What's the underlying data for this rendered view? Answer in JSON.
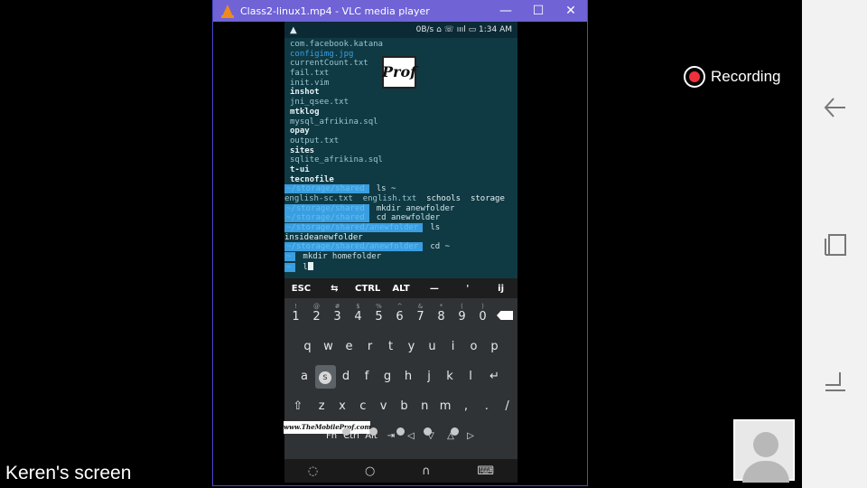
{
  "vlc": {
    "title": "Class2-linux1.mp4 - VLC media player",
    "minimize": "—",
    "maximize": "☐",
    "close": "✕"
  },
  "phone": {
    "status": {
      "warning": "▲",
      "indicators": "0B/s ⌂ ☏ ıııl ▭ 1:34 AM"
    },
    "logo_text": "Prof",
    "terminal": {
      "files": [
        {
          "text": "com.facebook.katana",
          "style": "plain"
        },
        {
          "text": "configimg.jpg",
          "style": "blue"
        },
        {
          "text": "currentCount.txt",
          "style": "plain"
        },
        {
          "text": "fail.txt",
          "style": "plain"
        },
        {
          "text": "init.vim",
          "style": "plain"
        },
        {
          "text": "inshot",
          "style": "bold"
        },
        {
          "text": "jni_qsee.txt",
          "style": "plain"
        },
        {
          "text": "mtklog",
          "style": "bold"
        },
        {
          "text": "mysql_afrikina.sql",
          "style": "plain"
        },
        {
          "text": "opay",
          "style": "bold"
        },
        {
          "text": "output.txt",
          "style": "plain"
        },
        {
          "text": "sites",
          "style": "bold"
        },
        {
          "text": "sqlite_afrikina.sql",
          "style": "plain"
        },
        {
          "text": "t-ui",
          "style": "bold"
        },
        {
          "text": "tecnofile",
          "style": "bold"
        }
      ],
      "session": [
        {
          "prompt": "~/storage/shared",
          "cmd": "ls ~"
        },
        {
          "output": [
            "english-sc.txt",
            "english.txt",
            "schools",
            "storage"
          ]
        },
        {
          "prompt": "~/storage/shared",
          "cmd": "mkdir anewfolder"
        },
        {
          "prompt": "~/storage/shared",
          "cmd": "cd anewfolder"
        },
        {
          "prompt": "~/storage/shared/anewfolder",
          "cmd": "ls"
        },
        {
          "output": [
            "insideanewfolder"
          ]
        },
        {
          "prompt": "~/storage/shared/anewfolder",
          "cmd": "cd ~"
        },
        {
          "prompt": "~",
          "cmd": "mkdir homefolder"
        },
        {
          "prompt": "~",
          "cmd": "l"
        }
      ]
    },
    "extra_keys": [
      "ESC",
      "⇆",
      "CTRL",
      "ALT",
      "—",
      "'",
      "ij"
    ],
    "keyboard": {
      "number_row": [
        {
          "k": "1",
          "s": "!"
        },
        {
          "k": "2",
          "s": "@"
        },
        {
          "k": "3",
          "s": "#"
        },
        {
          "k": "4",
          "s": "$"
        },
        {
          "k": "5",
          "s": "%"
        },
        {
          "k": "6",
          "s": "^"
        },
        {
          "k": "7",
          "s": "&"
        },
        {
          "k": "8",
          "s": "*"
        },
        {
          "k": "9",
          "s": "("
        },
        {
          "k": "0",
          "s": ")"
        }
      ],
      "row1": [
        "q",
        "w",
        "e",
        "r",
        "t",
        "y",
        "u",
        "i",
        "o",
        "p"
      ],
      "row2": [
        "a",
        "s",
        "d",
        "f",
        "g",
        "h",
        "j",
        "k",
        "l"
      ],
      "row3": [
        "z",
        "x",
        "c",
        "v",
        "b",
        "n",
        "m",
        ",",
        ".",
        "/"
      ],
      "pressed": "s",
      "bottom_row": [
        "Fn",
        "Ctrl",
        "Alt",
        "⇥",
        "◁",
        "▽",
        "△",
        "▷"
      ],
      "enter": "↵",
      "shift": "⇧"
    },
    "watermark": "www.TheMobileProf.com",
    "nav": [
      "◌",
      "○",
      "∩",
      "⌨"
    ]
  },
  "recording_label": "Recording",
  "screen_owner": "Keren's screen",
  "colors": {
    "rec": "#f0303a",
    "vlc_title": "#6f63d6",
    "terminal_bg": "#0f3a44",
    "prompt_bg": "#3a9ee0"
  }
}
